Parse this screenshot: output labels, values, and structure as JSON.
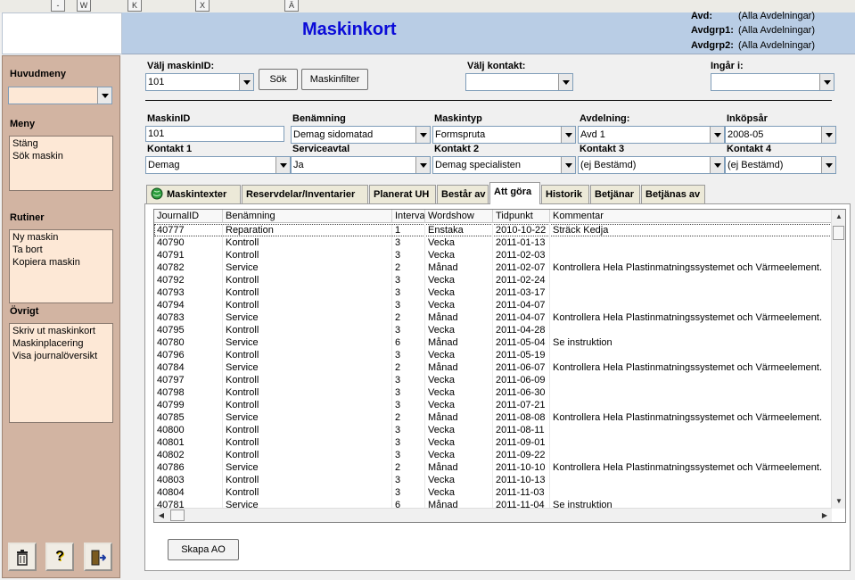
{
  "accesskeys": [
    "-",
    "W",
    "K",
    "X",
    "Ä"
  ],
  "header": {
    "title": "Maskinkort",
    "avd_label": "Avd:",
    "avd_value": "(Alla Avdelningar)",
    "avdgrp1_label": "Avdgrp1:",
    "avdgrp1_value": "(Alla Avdelningar)",
    "avdgrp2_label": "Avdgrp2:",
    "avdgrp2_value": "(Alla Avdelningar)"
  },
  "sidebar": {
    "huvudmeny_title": "Huvudmeny",
    "meny_title": "Meny",
    "meny_items": [
      "Stäng",
      "Sök maskin"
    ],
    "rutiner_title": "Rutiner",
    "rutiner_items": [
      "Ny maskin",
      "Ta bort",
      "Kopiera maskin"
    ],
    "ovrigt_title": "Övrigt",
    "ovrigt_items": [
      "Skriv ut maskinkort",
      "Maskinplacering",
      "Visa journalöversikt"
    ]
  },
  "search": {
    "maskinid_label": "Välj maskinID:",
    "maskinid_value": "101",
    "sok_button": "Sök",
    "filter_button": "Maskinfilter",
    "kontakt_label": "Välj kontakt:",
    "kontakt_value": "",
    "ingar_label": "Ingår i:",
    "ingar_value": ""
  },
  "details": {
    "maskinid_label": "MaskinID",
    "maskinid_value": "101",
    "benamning_label": "Benämning",
    "benamning_value": "Demag sidomatad",
    "maskintyp_label": "Maskintyp",
    "maskintyp_value": "Formspruta",
    "avdelning_label": "Avdelning:",
    "avdelning_value": "Avd 1",
    "inkopsar_label": "Inköpsår",
    "inkopsar_value": "2008-05",
    "kontakt1_label": "Kontakt 1",
    "kontakt1_value": "Demag",
    "serviceavtal_label": "Serviceavtal",
    "serviceavtal_value": "Ja",
    "kontakt2_label": "Kontakt 2",
    "kontakt2_value": "Demag specialisten",
    "kontakt3_label": "Kontakt 3",
    "kontakt3_value": "(ej Bestämd)",
    "kontakt4_label": "Kontakt 4",
    "kontakt4_value": "(ej Bestämd)"
  },
  "tabs": [
    "Maskintexter",
    "Reservdelar/Inventarier",
    "Planerat UH",
    "Består av",
    "Att göra",
    "Historik",
    "Betjänar",
    "Betjänas av"
  ],
  "active_tab": "Att göra",
  "grid": {
    "columns": [
      "JournalID",
      "Benämning",
      "Interva",
      "Wordshow",
      "Tidpunkt",
      "Kommentar"
    ],
    "rows": [
      [
        "40777",
        "Reparation",
        "1",
        "Enstaka",
        "2010-10-22",
        "Sträck Kedja"
      ],
      [
        "40790",
        "Kontroll",
        "3",
        "Vecka",
        "2011-01-13",
        ""
      ],
      [
        "40791",
        "Kontroll",
        "3",
        "Vecka",
        "2011-02-03",
        ""
      ],
      [
        "40782",
        "Service",
        "2",
        "Månad",
        "2011-02-07",
        "Kontrollera Hela Plastinmatningssystemet och Värmeelement."
      ],
      [
        "40792",
        "Kontroll",
        "3",
        "Vecka",
        "2011-02-24",
        ""
      ],
      [
        "40793",
        "Kontroll",
        "3",
        "Vecka",
        "2011-03-17",
        ""
      ],
      [
        "40794",
        "Kontroll",
        "3",
        "Vecka",
        "2011-04-07",
        ""
      ],
      [
        "40783",
        "Service",
        "2",
        "Månad",
        "2011-04-07",
        "Kontrollera Hela Plastinmatningssystemet och Värmeelement."
      ],
      [
        "40795",
        "Kontroll",
        "3",
        "Vecka",
        "2011-04-28",
        ""
      ],
      [
        "40780",
        "Service",
        "6",
        "Månad",
        "2011-05-04",
        "Se instruktion"
      ],
      [
        "40796",
        "Kontroll",
        "3",
        "Vecka",
        "2011-05-19",
        ""
      ],
      [
        "40784",
        "Service",
        "2",
        "Månad",
        "2011-06-07",
        "Kontrollera Hela Plastinmatningssystemet och Värmeelement."
      ],
      [
        "40797",
        "Kontroll",
        "3",
        "Vecka",
        "2011-06-09",
        ""
      ],
      [
        "40798",
        "Kontroll",
        "3",
        "Vecka",
        "2011-06-30",
        ""
      ],
      [
        "40799",
        "Kontroll",
        "3",
        "Vecka",
        "2011-07-21",
        ""
      ],
      [
        "40785",
        "Service",
        "2",
        "Månad",
        "2011-08-08",
        "Kontrollera Hela Plastinmatningssystemet och Värmeelement."
      ],
      [
        "40800",
        "Kontroll",
        "3",
        "Vecka",
        "2011-08-11",
        ""
      ],
      [
        "40801",
        "Kontroll",
        "3",
        "Vecka",
        "2011-09-01",
        ""
      ],
      [
        "40802",
        "Kontroll",
        "3",
        "Vecka",
        "2011-09-22",
        ""
      ],
      [
        "40786",
        "Service",
        "2",
        "Månad",
        "2011-10-10",
        "Kontrollera Hela Plastinmatningssystemet och Värmeelement."
      ],
      [
        "40803",
        "Kontroll",
        "3",
        "Vecka",
        "2011-10-13",
        ""
      ],
      [
        "40804",
        "Kontroll",
        "3",
        "Vecka",
        "2011-11-03",
        ""
      ],
      [
        "40781",
        "Service",
        "6",
        "Månad",
        "2011-11-04",
        "Se instruktion"
      ]
    ]
  },
  "skapa_ao_button": "Skapa AO",
  "icons": {
    "delete": "trash-icon",
    "help": "question-icon",
    "exit": "exit-door-icon",
    "tab_maskintexter": "globe-icon"
  }
}
